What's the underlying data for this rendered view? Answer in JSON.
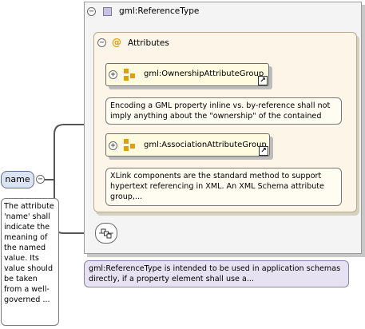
{
  "type": {
    "name": "gml:ReferenceType"
  },
  "attributes": {
    "label": "Attributes",
    "groups": [
      {
        "name": "gml:OwnershipAttributeGroup",
        "doc": "Encoding a GML property inline vs. by-reference shall not imply anything about the \"ownership\" of the contained or..."
      },
      {
        "name": "gml:AssociationAttributeGroup",
        "doc": "XLink components are the standard method to support hypertext referencing in XML. An XML Schema attribute group,..."
      }
    ]
  },
  "element": {
    "name": "name",
    "doc": "The attribute 'name' shall indicate the meaning of the named value. Its value should be taken from a well-governed ..."
  },
  "type_doc": "gml:ReferenceType is intended to be used in application schemas directly, if a property element shall use a...",
  "icons": {
    "collapse": "−",
    "expand": "+",
    "attribute_marker": "@",
    "link": "↗"
  },
  "colors": {
    "type_icon": "#c7c2df",
    "attribute_icon": "#e0a000",
    "element_fill": "#dbe4f2",
    "attr_panel": "#fdf6e8",
    "type_doc_fill": "#e6e2f1"
  }
}
